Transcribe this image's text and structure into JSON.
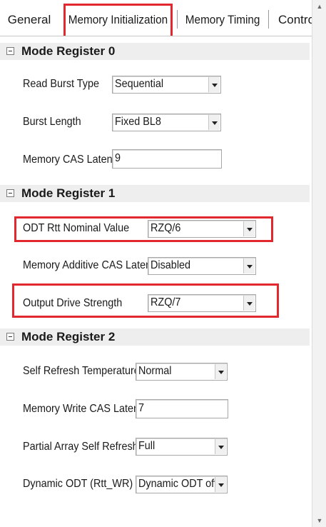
{
  "tabs": [
    {
      "label": "General"
    },
    {
      "label": "Memory Initialization",
      "active": true
    },
    {
      "label": "Memory Timing"
    },
    {
      "label": "Contro"
    }
  ],
  "sections": [
    {
      "title": "Mode Register 0",
      "fields": [
        {
          "label": "Read Burst Type",
          "type": "select",
          "value": "Sequential"
        },
        {
          "label": "Burst Length",
          "type": "select",
          "value": "Fixed BL8"
        },
        {
          "label": "Memory CAS Latency",
          "type": "text",
          "value": "9"
        }
      ]
    },
    {
      "title": "Mode Register 1",
      "fields": [
        {
          "label": "ODT Rtt Nominal Value",
          "type": "select",
          "value": "RZQ/6"
        },
        {
          "label": "Memory Additive CAS Latency",
          "type": "select",
          "value": "Disabled"
        },
        {
          "label": "Output Drive Strength",
          "type": "select",
          "value": "RZQ/7"
        }
      ]
    },
    {
      "title": "Mode Register 2",
      "fields": [
        {
          "label": "Self Refresh Temperature",
          "type": "select",
          "value": "Normal"
        },
        {
          "label": "Memory Write CAS Latency",
          "type": "text",
          "value": "7"
        },
        {
          "label": "Partial Array Self Refresh",
          "type": "select",
          "value": "Full"
        },
        {
          "label": "Dynamic ODT (Rtt_WR)",
          "type": "select",
          "value": "Dynamic ODT off"
        }
      ]
    }
  ],
  "colors": {
    "highlight": "#e0282e",
    "section_header_bg": "#eeeeee"
  }
}
